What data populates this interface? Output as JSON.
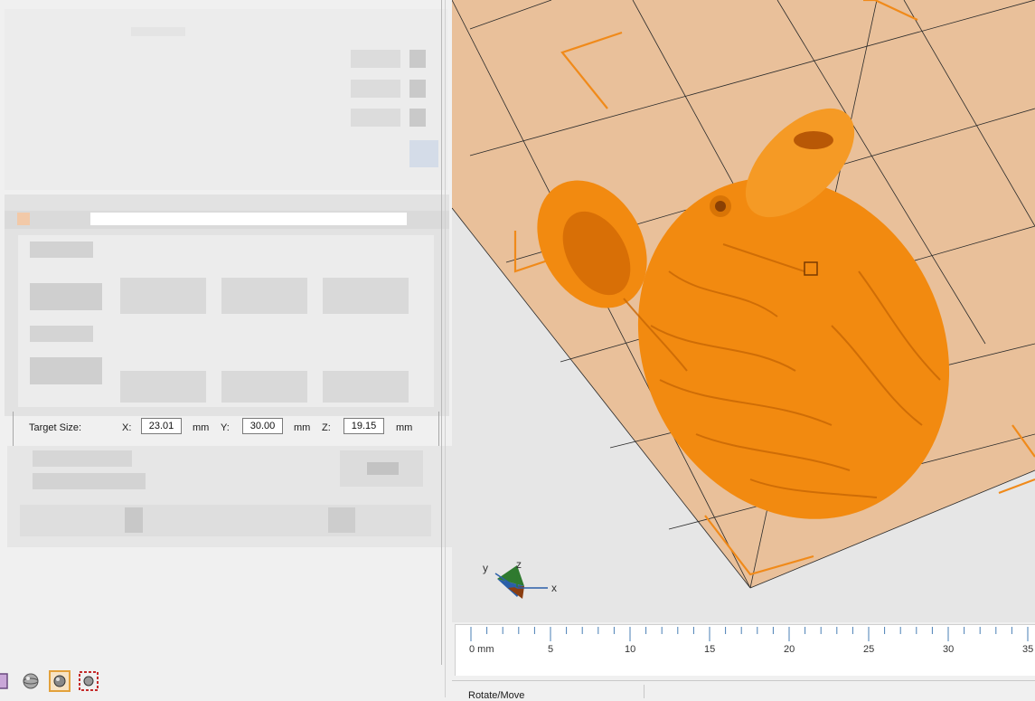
{
  "target_size": {
    "label": "Target Size:",
    "x_label": "X:",
    "x_value": "23.01",
    "y_label": "Y:",
    "y_value": "30.00",
    "z_label": "Z:",
    "z_value": "19.15",
    "unit": "mm"
  },
  "axis_triad": {
    "x": "x",
    "y": "y",
    "z": "z"
  },
  "ruler": {
    "ticks": [
      "0 mm",
      "5",
      "10",
      "15",
      "20",
      "25",
      "30",
      "35"
    ]
  },
  "status": {
    "mode": "Rotate/Move"
  },
  "colors": {
    "model": "#f28a10",
    "bed": "#e9c09a",
    "bed_grid": "#2a2a2a",
    "corner_marker": "#f08a1a",
    "background": "#e6e6e6"
  },
  "toolbar_icons": [
    "layer-view-icon",
    "sphere-icon",
    "solid-view-icon",
    "gear-grid-icon"
  ]
}
